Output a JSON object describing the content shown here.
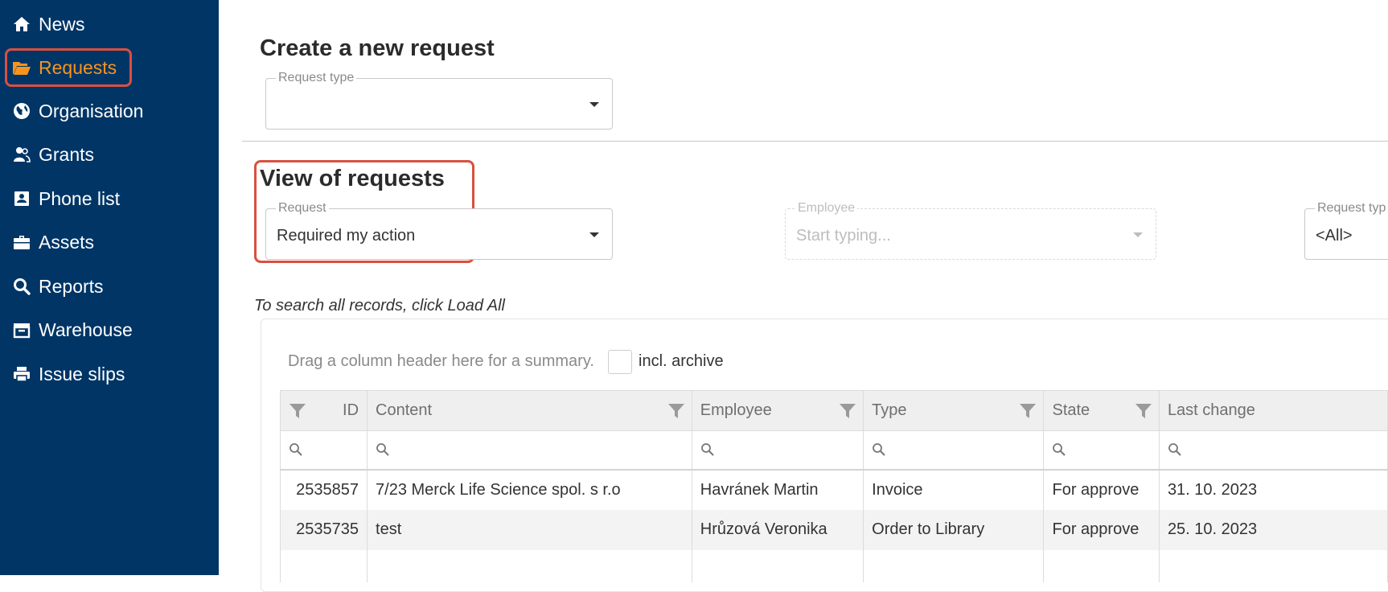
{
  "sidebar": {
    "items": [
      {
        "label": "News",
        "icon": "home-icon"
      },
      {
        "label": "Requests",
        "icon": "folder-open-icon",
        "active": true
      },
      {
        "label": "Organisation",
        "icon": "globe-icon"
      },
      {
        "label": "Grants",
        "icon": "users-icon"
      },
      {
        "label": "Phone list",
        "icon": "contact-card-icon"
      },
      {
        "label": "Assets",
        "icon": "briefcase-icon"
      },
      {
        "label": "Reports",
        "icon": "search-icon"
      },
      {
        "label": "Warehouse",
        "icon": "warehouse-icon"
      },
      {
        "label": "Issue slips",
        "icon": "printer-icon"
      }
    ],
    "active_color": "#f7941d",
    "background": "#003566"
  },
  "create": {
    "title": "Create a new request",
    "request_type_label": "Request type",
    "request_type_value": ""
  },
  "view": {
    "title": "View of requests",
    "request_label": "Request",
    "request_value": "Required my action",
    "employee_label": "Employee",
    "employee_placeholder": "Start typing...",
    "request_type_label": "Request typ",
    "request_type_value": "<All>"
  },
  "hint": "To search all records, click Load All",
  "grid": {
    "group_hint": "Drag a column header here for a summary.",
    "archive_label": "incl. archive",
    "columns": [
      "ID",
      "Content",
      "Employee",
      "Type",
      "State",
      "Last change"
    ],
    "rows": [
      [
        "2535857",
        "7/23 Merck Life Science spol. s r.o",
        "Havránek Martin",
        "Invoice",
        "For approve",
        "31. 10. 2023"
      ],
      [
        "2535735",
        "test",
        "Hrůzová Veronika",
        "Order to Library",
        "For approve",
        "25. 10. 2023"
      ]
    ]
  },
  "highlight_color": "#d9503f"
}
